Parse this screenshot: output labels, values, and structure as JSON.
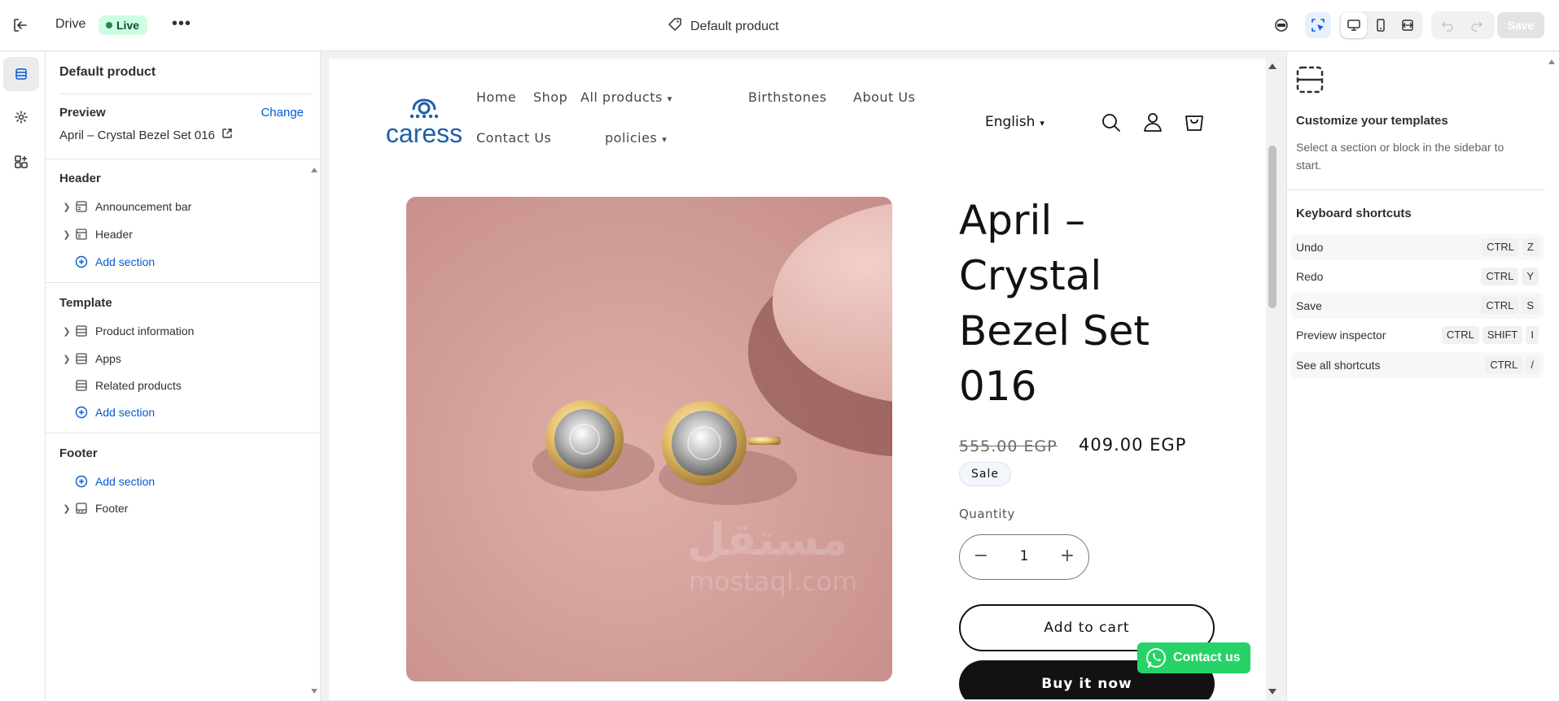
{
  "topbar": {
    "app_name": "Drive",
    "status": "Live",
    "more": "•••",
    "template_name": "Default product",
    "save_label": "Save"
  },
  "left_panel": {
    "title": "Default product",
    "preview_label": "Preview",
    "change_label": "Change",
    "preview_value": "April – Crystal Bezel Set 016",
    "groups": [
      {
        "title": "Header",
        "items": [
          {
            "label": "Announcement bar"
          },
          {
            "label": "Header"
          }
        ],
        "add_label": "Add section"
      },
      {
        "title": "Template",
        "items": [
          {
            "label": "Product information"
          },
          {
            "label": "Apps"
          },
          {
            "label": "Related products"
          }
        ],
        "add_label": "Add section"
      },
      {
        "title": "Footer",
        "add_label": "Add section",
        "items": [
          {
            "label": "Footer"
          }
        ]
      }
    ]
  },
  "store": {
    "logo_text": "caress",
    "nav": [
      "Home",
      "Shop",
      "All products",
      "Birthstones",
      "About Us",
      "Contact Us",
      "policies"
    ],
    "language": "English",
    "product": {
      "title": "April – Crystal Bezel Set 016",
      "title_lines": [
        "April –",
        "Crystal",
        "Bezel Set",
        "016"
      ],
      "price_old": "555.00 EGP",
      "price_new": "409.00 EGP",
      "badge": "Sale",
      "quantity_label": "Quantity",
      "quantity": "1",
      "add_to_cart": "Add to cart",
      "buy_now": "Buy it now"
    },
    "whatsapp_label": "Contact us",
    "watermark": "مستقل",
    "watermark_sub": "mostaql.com"
  },
  "right_panel": {
    "title": "Customize your templates",
    "description": "Select a section or block in the sidebar to start.",
    "shortcuts_title": "Keyboard shortcuts",
    "shortcuts": [
      {
        "label": "Undo",
        "keys": [
          "CTRL",
          "Z"
        ]
      },
      {
        "label": "Redo",
        "keys": [
          "CTRL",
          "Y"
        ]
      },
      {
        "label": "Save",
        "keys": [
          "CTRL",
          "S"
        ]
      },
      {
        "label": "Preview inspector",
        "keys": [
          "CTRL",
          "SHIFT",
          "I"
        ]
      },
      {
        "label": "See all shortcuts",
        "keys": [
          "CTRL",
          "/"
        ]
      }
    ]
  },
  "colors": {
    "accent_link": "#005bd3",
    "live_badge_bg": "#cdfee1",
    "product_bg": "#d9a6a2",
    "whatsapp": "#25d366",
    "logo_blue": "#1e5fa8"
  },
  "icons": [
    "exit-icon",
    "tag-icon",
    "inspector-icon",
    "selector-icon",
    "desktop-icon",
    "mobile-icon",
    "fullwidth-icon",
    "undo-icon",
    "redo-icon",
    "sections-icon",
    "settings-icon",
    "apps-icon",
    "section-icon",
    "add-circle-icon",
    "external-link-icon",
    "search-icon",
    "account-icon",
    "cart-icon",
    "whatsapp-icon"
  ]
}
